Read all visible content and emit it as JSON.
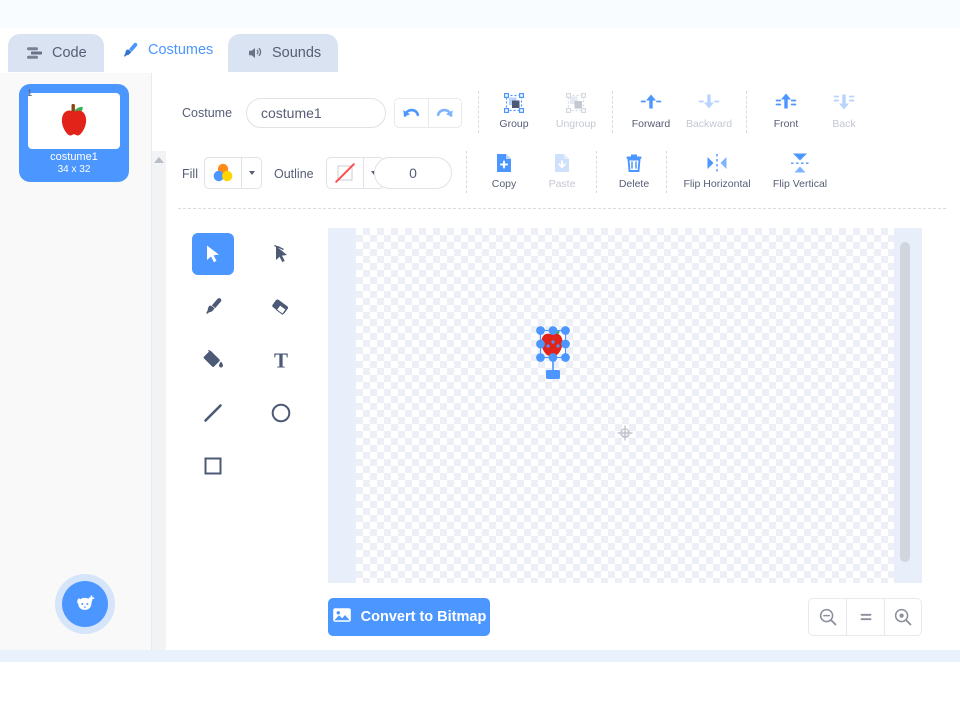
{
  "tabs": [
    {
      "label": "Code",
      "icon": "code-icon",
      "active": false
    },
    {
      "label": "Costumes",
      "icon": "brush-icon",
      "active": true
    },
    {
      "label": "Sounds",
      "icon": "speaker-icon",
      "active": false
    }
  ],
  "costume_list": {
    "items": [
      {
        "number": "1",
        "name": "costume1",
        "size": "34 x 32",
        "selected": true
      }
    ],
    "add_button": "add-costume-button"
  },
  "toolbar": {
    "costume_label": "Costume",
    "costume_name_value": "costume1",
    "costume_name_placeholder": "costume1",
    "undo": "Undo",
    "redo": "Redo",
    "group": "Group",
    "ungroup": "Ungroup",
    "forward": "Forward",
    "backward": "Backward",
    "front": "Front",
    "back": "Back",
    "fill_label": "Fill",
    "outline_label": "Outline",
    "outline_width_value": "0",
    "copy": "Copy",
    "paste": "Paste",
    "delete": "Delete",
    "flip_horizontal": "Flip Horizontal",
    "flip_vertical": "Flip Vertical",
    "disabled": [
      "Ungroup",
      "Backward",
      "Back",
      "Paste"
    ]
  },
  "tools": [
    {
      "name": "select",
      "active": true
    },
    {
      "name": "reshape",
      "active": false
    },
    {
      "name": "brush",
      "active": false
    },
    {
      "name": "eraser",
      "active": false
    },
    {
      "name": "fill",
      "active": false
    },
    {
      "name": "text",
      "active": false
    },
    {
      "name": "line",
      "active": false
    },
    {
      "name": "circle",
      "active": false
    },
    {
      "name": "rectangle",
      "active": false
    }
  ],
  "canvas": {
    "mode_button": "Convert to Bitmap",
    "zoom_out": "-",
    "zoom_reset": "=",
    "zoom_in": "+"
  },
  "colors": {
    "accent": "#4c97ff",
    "text": "#575e75",
    "disabled_text": "#c3c8d2",
    "tab_inactive_bg": "#d9e3f2",
    "fill_swatch": [
      "#ff8c1a",
      "#4c97ff",
      "#ffd500"
    ],
    "apple_red": "#e2231a",
    "apple_leaf": "#3cb054",
    "apple_stem": "#8b4513"
  }
}
